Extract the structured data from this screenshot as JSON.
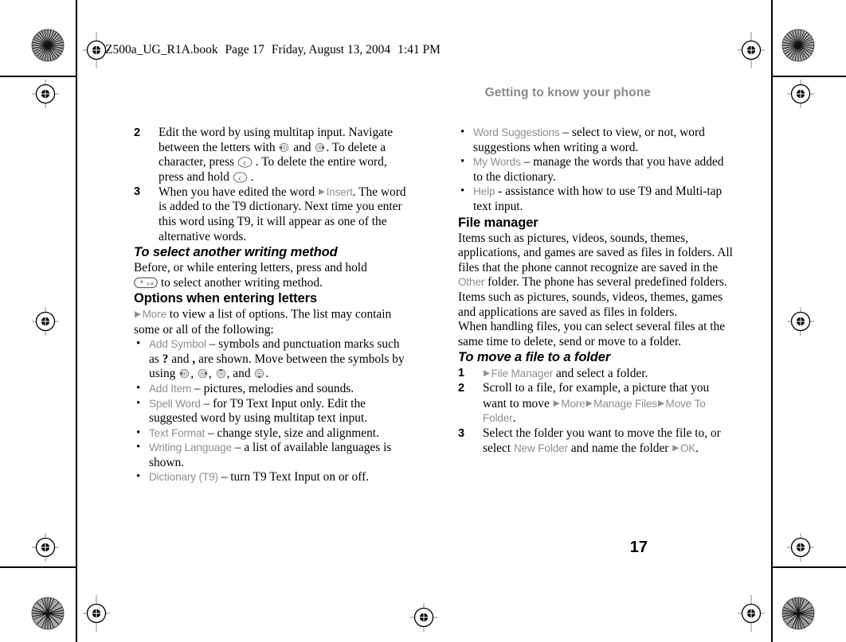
{
  "book_header": {
    "filename": "Z500a_UG_R1A.book",
    "page_label": "Page 17",
    "date": "Friday, August 13, 2004",
    "time": "1:41 PM"
  },
  "running_head": "Getting to know your phone",
  "folio": "17",
  "left_column": {
    "steps_continued": [
      {
        "num": "2",
        "parts": [
          {
            "t": "text",
            "v": "Edit the word by using multitap input. Navigate between the letters with "
          },
          {
            "t": "icon",
            "v": "joystick-left"
          },
          {
            "t": "text",
            "v": " and "
          },
          {
            "t": "icon",
            "v": "joystick-right"
          },
          {
            "t": "text",
            "v": ". To delete a character, press "
          },
          {
            "t": "icon",
            "v": "clear-key"
          },
          {
            "t": "text",
            "v": " . To delete the entire word, press and hold "
          },
          {
            "t": "icon",
            "v": "clear-key"
          },
          {
            "t": "text",
            "v": " ."
          }
        ]
      },
      {
        "num": "3",
        "parts": [
          {
            "t": "text",
            "v": "When you have edited the word "
          },
          {
            "t": "arrow",
            "v": "▶"
          },
          {
            "t": "ui",
            "v": "Insert"
          },
          {
            "t": "text",
            "v": ". The word is added to the T9 dictionary. Next time you enter this word using T9, it will appear as one of the alternative words."
          }
        ]
      }
    ],
    "heading_writing_method": "To select another writing method",
    "writing_method_text_before": "Before, or while entering letters, press and hold ",
    "writing_method_key": "star-key",
    "writing_method_text_after": " to select another writing method.",
    "heading_options": "Options when entering letters",
    "options_intro": {
      "arrow": "▶",
      "ui": "More",
      "text": " to view a list of options. The list may contain some or all of the following:"
    },
    "options_bullets": [
      {
        "label": "Add Symbol",
        "parts": [
          {
            "t": "text",
            "v": " – symbols and punctuation marks such as "
          },
          {
            "t": "bold",
            "v": "?"
          },
          {
            "t": "text",
            "v": " and "
          },
          {
            "t": "bold",
            "v": ","
          },
          {
            "t": "text",
            "v": " are shown. Move between the symbols by using "
          },
          {
            "t": "icon",
            "v": "joystick-left"
          },
          {
            "t": "text",
            "v": ", "
          },
          {
            "t": "icon",
            "v": "joystick-right"
          },
          {
            "t": "text",
            "v": ", "
          },
          {
            "t": "icon",
            "v": "joystick-up"
          },
          {
            "t": "text",
            "v": ", and "
          },
          {
            "t": "icon",
            "v": "joystick-down"
          },
          {
            "t": "text",
            "v": "."
          }
        ]
      },
      {
        "label": "Add Item",
        "parts": [
          {
            "t": "text",
            "v": " – pictures, melodies and sounds."
          }
        ]
      },
      {
        "label": "Spell Word",
        "parts": [
          {
            "t": "text",
            "v": " – for T9 Text Input only. Edit the suggested word by using multitap text input."
          }
        ]
      },
      {
        "label": "Text Format",
        "parts": [
          {
            "t": "text",
            "v": " – change style, size and alignment."
          }
        ]
      },
      {
        "label": "Writing Language",
        "parts": [
          {
            "t": "text",
            "v": " – a list of available languages is shown."
          }
        ]
      },
      {
        "label": "Dictionary (T9)",
        "parts": [
          {
            "t": "text",
            "v": " – turn T9 Text Input on or off."
          }
        ]
      }
    ]
  },
  "right_column": {
    "options_bullets_continued": [
      {
        "label": "Word Suggestions",
        "parts": [
          {
            "t": "text",
            "v": " – select to view, or not, word suggestions when writing a word."
          }
        ]
      },
      {
        "label": "My Words",
        "parts": [
          {
            "t": "text",
            "v": " – manage the words that you have added to the dictionary."
          }
        ]
      },
      {
        "label": "Help",
        "parts": [
          {
            "t": "text",
            "v": " - assistance with how to use T9 and Multi-tap text input."
          }
        ]
      }
    ],
    "heading_file_manager": "File manager",
    "file_manager_para_1": [
      {
        "t": "text",
        "v": "Items such as pictures, videos, sounds, themes, applications, and games are saved as files in folders. All files that the phone cannot recognize are saved in the "
      },
      {
        "t": "ui",
        "v": "Other"
      },
      {
        "t": "text",
        "v": " folder. The phone has several predefined folders. Items such as pictures, sounds, videos, themes, games and applications are saved as files in folders."
      }
    ],
    "file_manager_para_2": "When handling files, you can select several files at the same time to delete, send or move to a folder.",
    "heading_move_file": "To move a file to a folder",
    "move_file_steps": [
      {
        "num": "1",
        "parts": [
          {
            "t": "arrow",
            "v": "▶"
          },
          {
            "t": "ui",
            "v": "File Manager"
          },
          {
            "t": "text",
            "v": " and select a folder."
          }
        ]
      },
      {
        "num": "2",
        "parts": [
          {
            "t": "text",
            "v": "Scroll to a file, for example, a picture that you want to move "
          },
          {
            "t": "arrow",
            "v": "▶"
          },
          {
            "t": "ui",
            "v": "More"
          },
          {
            "t": "arrow",
            "v": "▶"
          },
          {
            "t": "ui",
            "v": "Manage Files"
          },
          {
            "t": "arrow",
            "v": "▶"
          },
          {
            "t": "ui",
            "v": "Move To Folder"
          },
          {
            "t": "text",
            "v": "."
          }
        ]
      },
      {
        "num": "3",
        "parts": [
          {
            "t": "text",
            "v": "Select the folder you want to move the file to, or select "
          },
          {
            "t": "ui",
            "v": "New Folder"
          },
          {
            "t": "text",
            "v": " and name the folder "
          },
          {
            "t": "arrow",
            "v": "▶"
          },
          {
            "t": "ui",
            "v": "OK"
          },
          {
            "t": "text",
            "v": "."
          }
        ]
      }
    ]
  },
  "colors": {
    "ui_label": "#8f8f8f",
    "running_head": "#8a8a8a",
    "body_text": "#000000"
  },
  "print_marks": {
    "registration_targets": 8,
    "star_targets": 4,
    "description": "printer registration crosshair and radial star targets at page corners and edge centers"
  }
}
